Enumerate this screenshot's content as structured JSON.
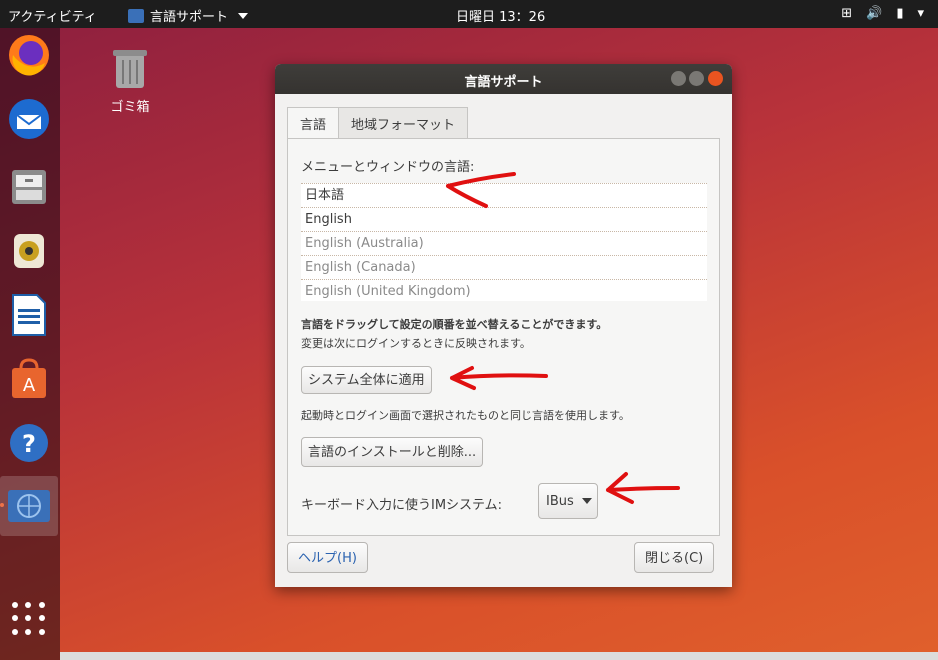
{
  "topbar": {
    "activities": "アクティビティ",
    "app_menu": "言語サポート",
    "clock": "日曜日 13：26"
  },
  "desktop": {
    "trash_label": "ゴミ箱"
  },
  "dialog": {
    "title": "言語サポート",
    "tabs": [
      "言語",
      "地域フォーマット"
    ],
    "menu_lang_label": "メニューとウィンドウの言語:",
    "languages": [
      "日本語",
      "English",
      "English (Australia)",
      "English (Canada)",
      "English (United Kingdom)"
    ],
    "drag_note": "言語をドラッグして設定の順番を並べ替えることができます。",
    "relogin_note": "変更は次にログインするときに反映されます。",
    "apply_button": "システム全体に適用",
    "apply_note": "起動時とログイン画面で選択されたものと同じ言語を使用します。",
    "install_button": "言語のインストールと削除...",
    "im_label": "キーボード入力に使うIMシステム:",
    "im_value": "IBus",
    "help_button": "ヘルプ(H)",
    "close_button": "閉じる(C)"
  },
  "colors": {
    "accent": "#e95420",
    "annotation": "#e01010"
  }
}
